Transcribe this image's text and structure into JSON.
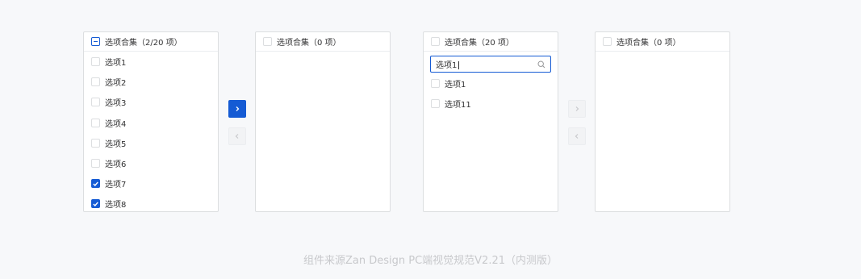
{
  "transfer_1": {
    "source": {
      "header": "选项合集（2/20 项）",
      "items": [
        {
          "label": "选项1",
          "checked": false
        },
        {
          "label": "选项2",
          "checked": false
        },
        {
          "label": "选项3",
          "checked": false
        },
        {
          "label": "选项4",
          "checked": false
        },
        {
          "label": "选项5",
          "checked": false
        },
        {
          "label": "选项6",
          "checked": false
        },
        {
          "label": "选项7",
          "checked": true
        },
        {
          "label": "选项8",
          "checked": true
        }
      ]
    },
    "target": {
      "header": "选项合集（0 项）",
      "items": []
    }
  },
  "transfer_2": {
    "source": {
      "header": "选项合集（20 项）",
      "search_value": "选项1",
      "items": [
        {
          "label": "选项1",
          "checked": false
        },
        {
          "label": "选项11",
          "checked": false
        }
      ]
    },
    "target": {
      "header": "选项合集（0 项）",
      "items": []
    }
  },
  "footer_text": "组件来源Zan Design PC端视觉规范V2.21（内测版）",
  "colors": {
    "primary": "#155bd4",
    "border": "#dcdee0",
    "background": "#f7f8fa",
    "footer": "#c8c9cc"
  },
  "icons": {
    "move_right": "chevron-right-icon",
    "move_left": "chevron-left-icon",
    "search": "search-icon"
  }
}
